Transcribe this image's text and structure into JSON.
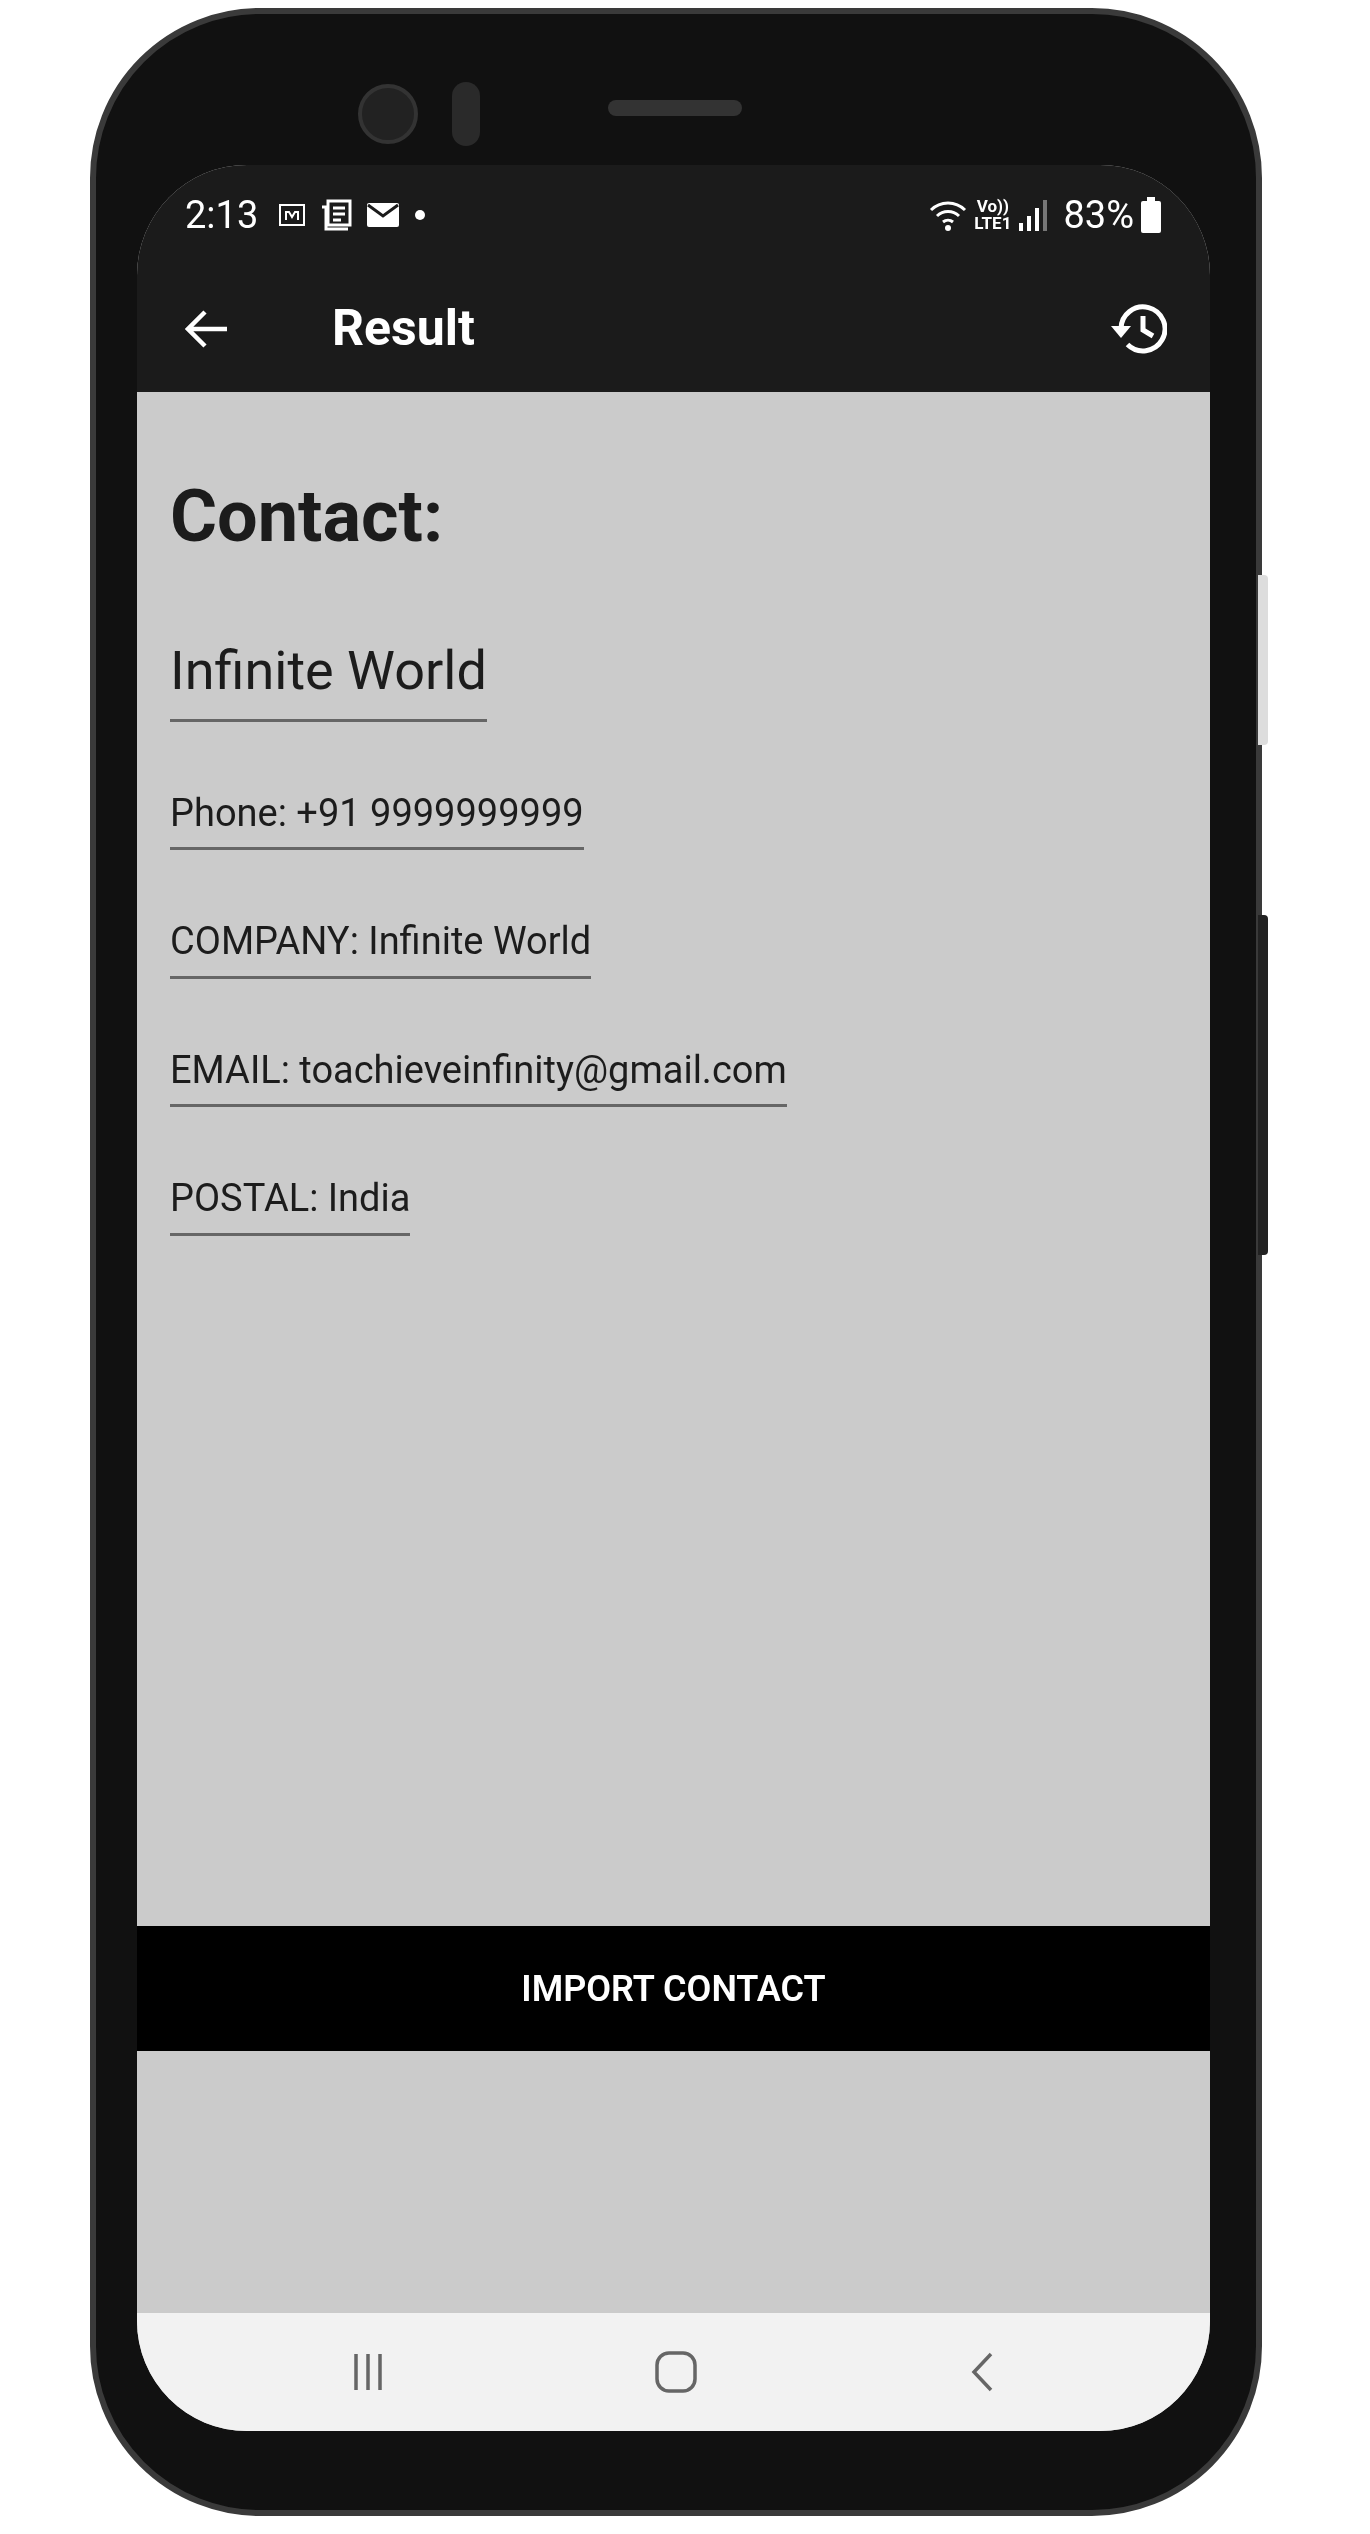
{
  "status_bar": {
    "time": "2:13",
    "network_top": "Vo))",
    "network_bottom": "LTE1",
    "battery": "83%"
  },
  "app_bar": {
    "title": "Result"
  },
  "heading": "Contact:",
  "name": "Infinite World",
  "fields": [
    "Phone: +91 9999999999",
    "COMPANY: Infinite World",
    "EMAIL: toachieveinfinity@gmail.com",
    "POSTAL: India"
  ],
  "import_button": "IMPORT CONTACT"
}
